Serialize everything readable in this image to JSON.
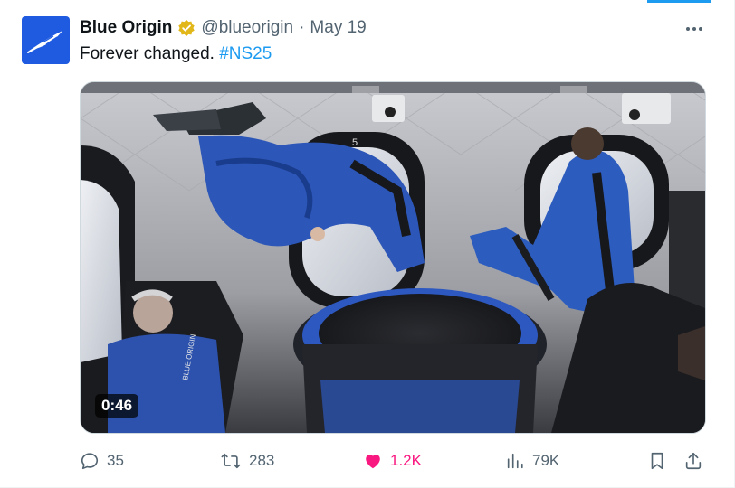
{
  "author": {
    "display_name": "Blue Origin",
    "handle": "@blueorigin",
    "separator": "·",
    "date": "May 19",
    "avatar_icon": "feather-logo-icon",
    "verified_icon": "verified-badge-icon",
    "verified_color": "#e2b719",
    "brand_color": "#1f5be0"
  },
  "tweet": {
    "text": "Forever changed.",
    "hashtag": "#NS25"
  },
  "media": {
    "type": "video",
    "duration": "0:46",
    "module_label": "5",
    "suit_label": "BLUE ORIGIN"
  },
  "actions": {
    "replies": "35",
    "reposts": "283",
    "likes": "1.2K",
    "views": "79K",
    "liked": true
  },
  "colors": {
    "accent": "#1d9bf0",
    "like": "#f91880",
    "muted": "#536471"
  }
}
